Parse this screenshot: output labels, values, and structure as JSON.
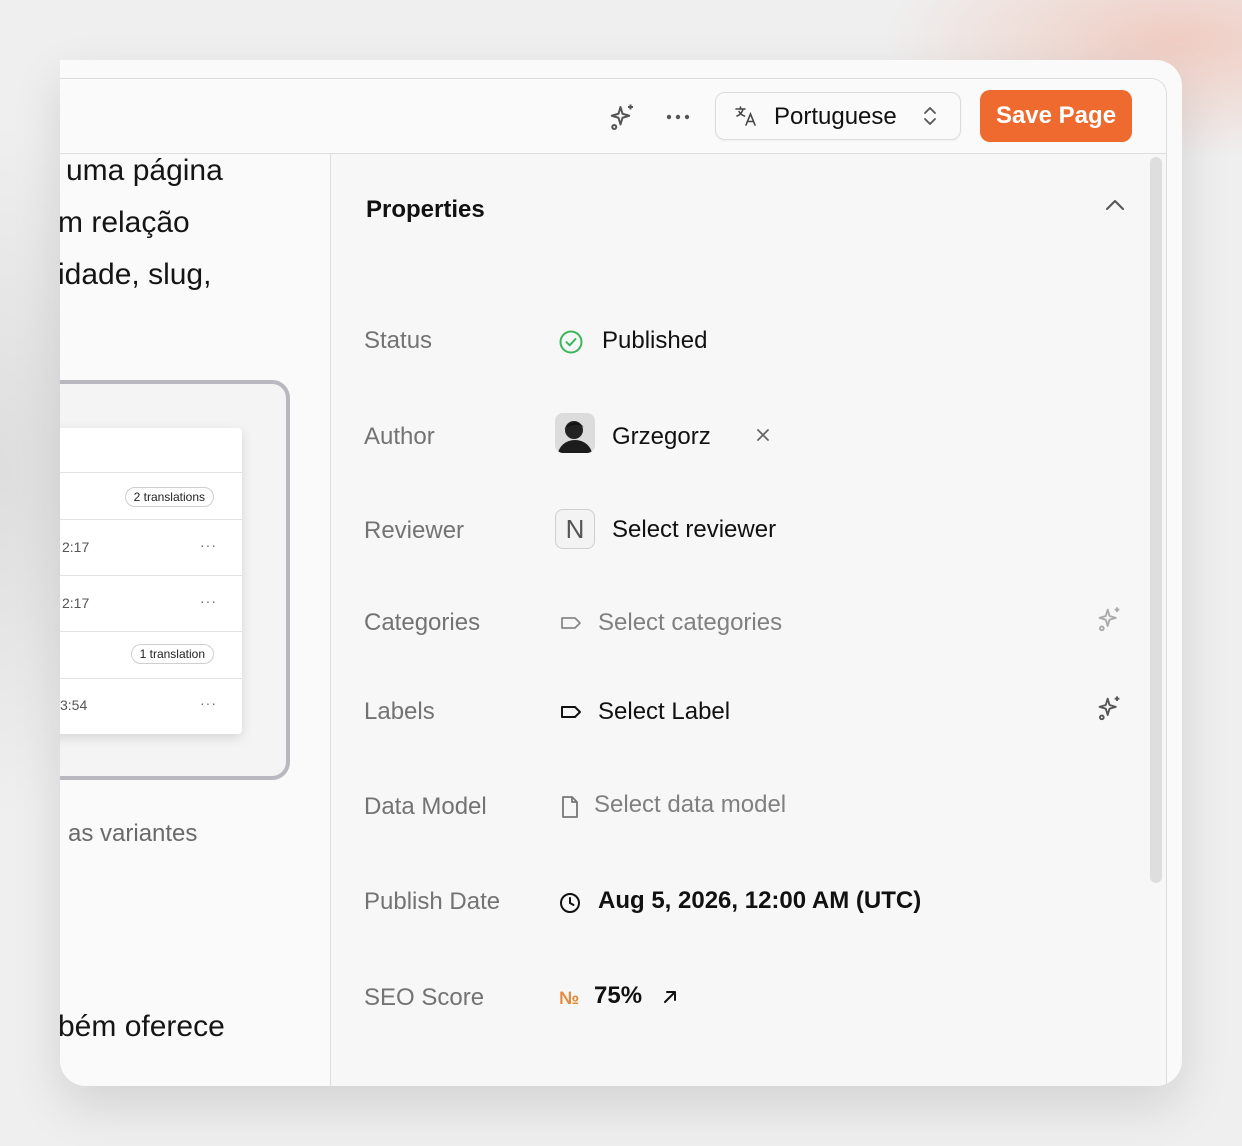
{
  "topbar": {
    "language": "Portuguese",
    "save_label": "Save Page"
  },
  "left": {
    "lines": [
      "uma página",
      "m relação",
      "idade, slug,"
    ],
    "variants_text": "as variantes",
    "bottom_text": "bém oferece",
    "mock": {
      "pill_1": "2 translations",
      "row_time_1": "2:17",
      "row_time_2": "2:17",
      "pill_2": "1 translation",
      "row_time_3": "3:54",
      "dots": "···"
    }
  },
  "properties": {
    "title": "Properties",
    "status": {
      "label": "Status",
      "value": "Published"
    },
    "author": {
      "label": "Author",
      "value": "Grzegorz"
    },
    "reviewer": {
      "label": "Reviewer",
      "value": "Select reviewer",
      "badge": "N"
    },
    "categories": {
      "label": "Categories",
      "value": "Select categories"
    },
    "labels": {
      "label": "Labels",
      "value": "Select Label"
    },
    "data_model": {
      "label": "Data Model",
      "value": "Select data model"
    },
    "publish_date": {
      "label": "Publish Date",
      "value": "Aug 5, 2026, 12:00 AM (UTC)"
    },
    "seo_score": {
      "label": "SEO Score",
      "badge": "№",
      "value": "75%"
    }
  },
  "colors": {
    "accent": "#ee6a2f",
    "success": "#3cb65a",
    "seo_badge": "#e68a3a"
  }
}
